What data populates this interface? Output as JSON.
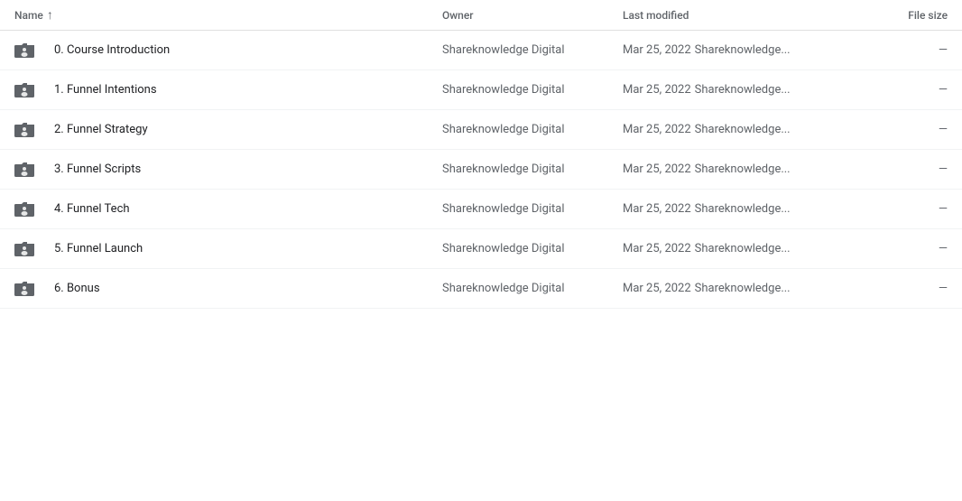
{
  "columns": {
    "name": "Name",
    "owner": "Owner",
    "last_modified": "Last modified",
    "file_size": "File size"
  },
  "rows": [
    {
      "id": 0,
      "name": "0. Course Introduction",
      "owner": "Shareknowledge Digital",
      "date": "Mar 25, 2022",
      "modifier": "Shareknowledge...",
      "size": "—"
    },
    {
      "id": 1,
      "name": "1. Funnel Intentions",
      "owner": "Shareknowledge Digital",
      "date": "Mar 25, 2022",
      "modifier": "Shareknowledge...",
      "size": "—"
    },
    {
      "id": 2,
      "name": "2. Funnel Strategy",
      "owner": "Shareknowledge Digital",
      "date": "Mar 25, 2022",
      "modifier": "Shareknowledge...",
      "size": "—"
    },
    {
      "id": 3,
      "name": "3. Funnel Scripts",
      "owner": "Shareknowledge Digital",
      "date": "Mar 25, 2022",
      "modifier": "Shareknowledge...",
      "size": "—"
    },
    {
      "id": 4,
      "name": "4. Funnel Tech",
      "owner": "Shareknowledge Digital",
      "date": "Mar 25, 2022",
      "modifier": "Shareknowledge...",
      "size": "—"
    },
    {
      "id": 5,
      "name": "5. Funnel Launch",
      "owner": "Shareknowledge Digital",
      "date": "Mar 25, 2022",
      "modifier": "Shareknowledge...",
      "size": "—"
    },
    {
      "id": 6,
      "name": "6. Bonus",
      "owner": "Shareknowledge Digital",
      "date": "Mar 25, 2022",
      "modifier": "Shareknowledge...",
      "size": "—"
    }
  ]
}
